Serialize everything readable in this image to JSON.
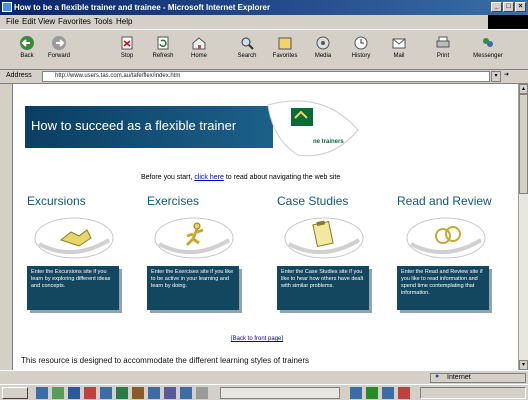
{
  "window": {
    "title": "How to be a flexible trainer and trainee - Microsoft Internet Explorer"
  },
  "menu": [
    "File",
    "Edit",
    "View",
    "Favorites",
    "Tools",
    "Help"
  ],
  "toolbar": {
    "buttons": [
      {
        "label": "Back",
        "icon": "back-arrow-icon"
      },
      {
        "label": "Forward",
        "icon": "forward-arrow-icon"
      },
      {
        "label": "Stop",
        "icon": "stop-icon"
      },
      {
        "label": "Refresh",
        "icon": "refresh-icon"
      },
      {
        "label": "Home",
        "icon": "home-icon"
      },
      {
        "label": "Search",
        "icon": "search-icon"
      },
      {
        "label": "Favorites",
        "icon": "favorites-icon"
      },
      {
        "label": "Media",
        "icon": "media-icon"
      },
      {
        "label": "History",
        "icon": "history-icon"
      },
      {
        "label": "Mail",
        "icon": "mail-icon"
      },
      {
        "label": "Print",
        "icon": "print-icon"
      },
      {
        "label": "Messenger",
        "icon": "messenger-icon"
      }
    ]
  },
  "address": {
    "label": "Address",
    "url": "http://www.users.tas.com.au/tafe/flex/index.htm"
  },
  "page": {
    "banner_title": "How to succeed as a flexible trainer",
    "logo_text": "ne trainers",
    "intro_prefix": "Before you start,",
    "intro_link": "click here",
    "intro_suffix": "to read about navigating the web site",
    "sections": [
      {
        "title": "Excursions",
        "desc": "Enter the Excursions site if you learn by exploring different ideas and concepts."
      },
      {
        "title": "Exercises",
        "desc": "Enter the Exercises site if you like to be active in your learning and learn by doing."
      },
      {
        "title": "Case Studies",
        "desc": "Enter the Case Studies site if you like to hear how others have dealt with similar problems."
      },
      {
        "title": "Read and Review",
        "desc": "Enter the Read and Review site if you like to read information and spend time contemplating that information."
      }
    ],
    "bottom_link": "[Back to front page]",
    "resource_text": "This resource is designed to accommodate the different learning styles of trainers"
  },
  "status": {
    "zone": "Internet"
  },
  "colors": {
    "banner": "#0b3e62",
    "section_heading": "#0e5a7c",
    "card_bg": "#134760",
    "accent_green": "#0b6b35",
    "oval_yellow": "#e8d66a"
  }
}
